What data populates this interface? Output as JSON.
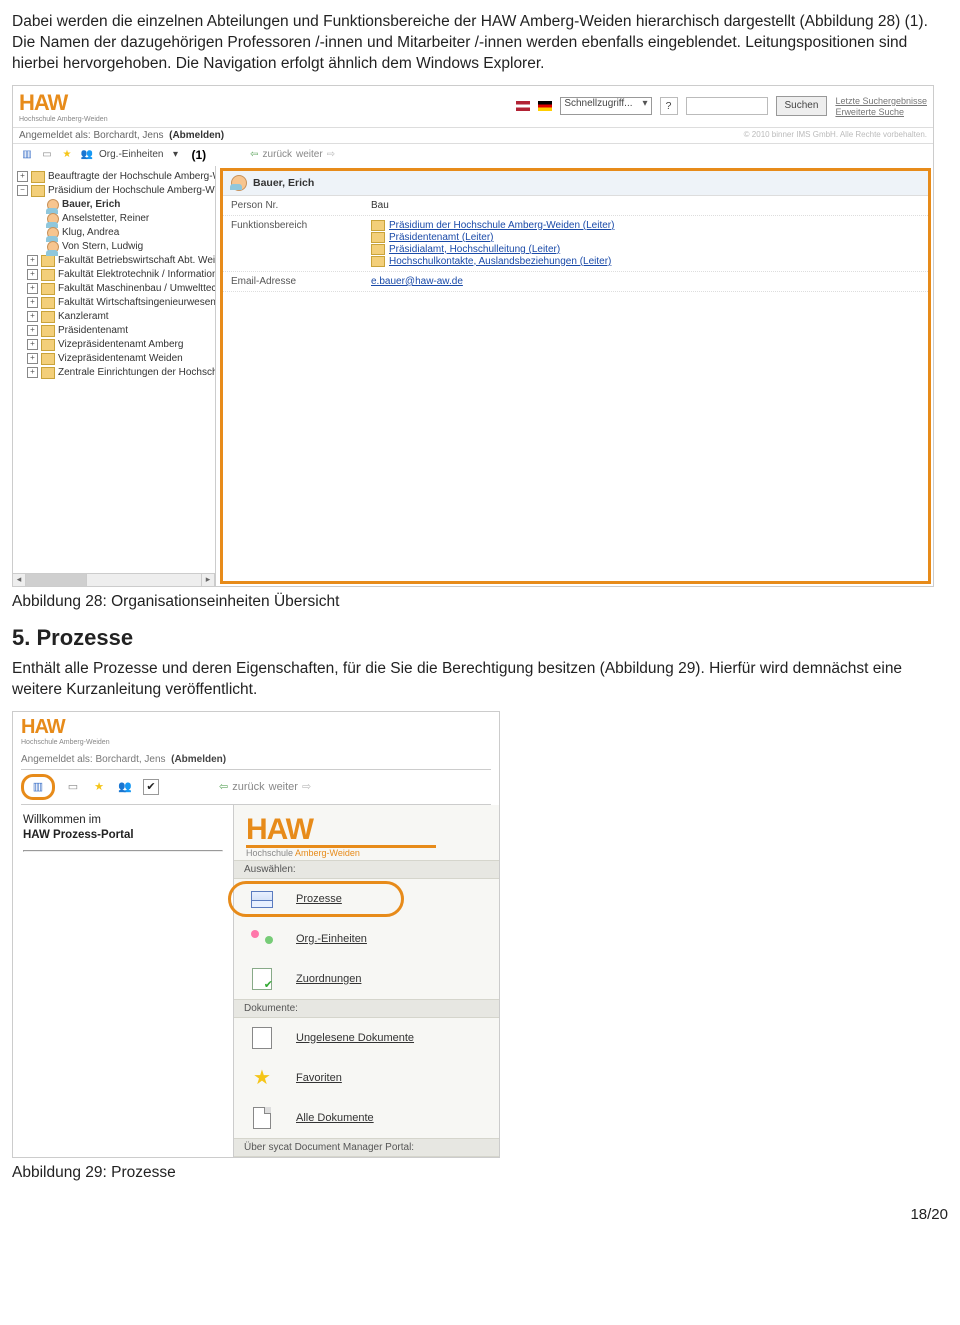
{
  "para1": "Dabei werden die einzelnen Abteilungen und Funktionsbereiche der HAW Amberg-Weiden hierarchisch dargestellt (Abbildung 28) (1). Die Namen der dazugehörigen Professoren /-innen und Mitarbeiter /-innen werden ebenfalls eingeblendet. Leitungspositionen sind hierbei hervorgehoben. Die Navigation erfolgt ähnlich dem Windows Explorer.",
  "caption1": "Abbildung 28: Organisationseinheiten Übersicht",
  "sectionTitle": "5. Prozesse",
  "para2": "Enthält alle Prozesse und deren Eigenschaften, für die Sie die Berechtigung besitzen (Abbildung 29). Hierfür wird demnächst eine weitere Kurzanleitung veröffentlicht.",
  "caption2": "Abbildung 29: Prozesse",
  "pageNum": "18/20",
  "shot1": {
    "logo": "HAW",
    "logosub": "Hochschule Amberg-Weiden",
    "quick": "Schnellzugriff...",
    "searchBtn": "Suchen",
    "rlink1": "Letzte Suchergebnisse",
    "rlink2": "Erweiterte Suche",
    "loginPre": "Angemeldet als: ",
    "loginName": "Borchardt, Jens",
    "logout": "(Abmelden)",
    "copyright": "© 2010 binner IMS GmbH. Alle Rechte vorbehalten.",
    "orgLabel": "Org.-Einheiten",
    "annot": "(1)",
    "back": "zurück",
    "fwd": "weiter",
    "tree": [
      "Beauftragte der Hochschule Amberg-Weiden",
      "Präsidium der Hochschule Amberg-Weiden",
      "Bauer, Erich",
      "Anselstetter, Reiner",
      "Klug, Andrea",
      "Von Stern, Ludwig",
      "Fakultät Betriebswirtschaft Abt. Weiden",
      "Fakultät Elektrotechnik / Informationstechnik",
      "Fakultät Maschinenbau / Umwelttechnik Amberg",
      "Fakultät Wirtschaftsingenieurwesen Abt.",
      "Kanzleramt",
      "Präsidentenamt",
      "Vizepräsidentenamt Amberg",
      "Vizepräsidentenamt Weiden",
      "Zentrale Einrichtungen der Hochschule Amberg-Weiden"
    ],
    "detailName": "Bauer, Erich",
    "rowLab1": "Person Nr.",
    "rowVal1": "Bau",
    "rowLab2": "Funktionsbereich",
    "fb": [
      "Präsidium der Hochschule Amberg-Weiden (Leiter)",
      "Präsidentenamt (Leiter)",
      "Präsidialamt, Hochschulleitung (Leiter)",
      "Hochschulkontakte, Auslandsbeziehungen (Leiter)"
    ],
    "rowLab3": "Email-Adresse",
    "email": "e.bauer@haw-aw.de"
  },
  "shot2": {
    "logo": "HAW",
    "logosub": "Hochschule Amberg-Weiden",
    "loginPre": "Angemeldet als: ",
    "loginName": "Borchardt, Jens",
    "logout": "(Abmelden)",
    "back": "zurück",
    "fwd": "weiter",
    "welcome1": "Willkommen im",
    "welcome2": "HAW Prozess-Portal",
    "logoSubBig1": "Hochschule ",
    "logoSubBig2": "Amberg-Weiden",
    "sec1": "Auswählen:",
    "i1": "Prozesse",
    "i2": "Org.-Einheiten",
    "i3": "Zuordnungen",
    "sec2": "Dokumente:",
    "i4": "Ungelesene Dokumente",
    "i5": "Favoriten",
    "i6": "Alle Dokumente",
    "sec3": "Über sycat Document Manager Portal:"
  }
}
